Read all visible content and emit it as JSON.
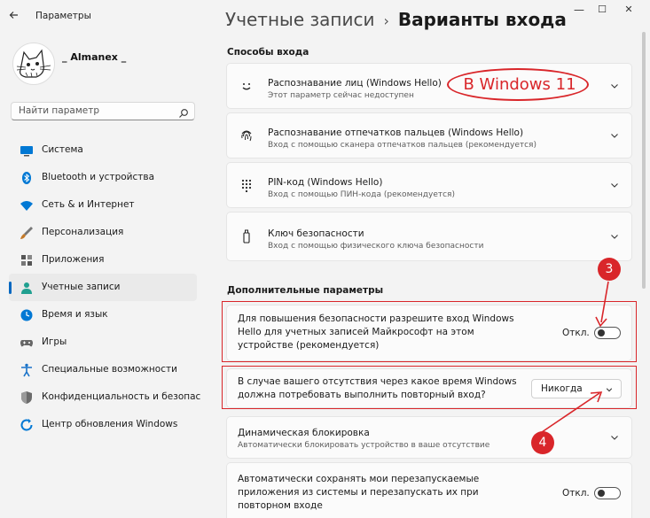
{
  "window": {
    "title": "Параметры",
    "minimize": "—",
    "maximize": "☐",
    "close": "✕"
  },
  "user": {
    "name": "_ Almanex _"
  },
  "search": {
    "placeholder": "Найти параметр"
  },
  "nav": [
    {
      "label": "Система",
      "icon": "monitor-icon",
      "color": "#0078d4"
    },
    {
      "label": "Bluetooth и устройства",
      "icon": "bluetooth-icon",
      "color": "#0078d4"
    },
    {
      "label": "Сеть & и Интернет",
      "icon": "wifi-icon",
      "color": "#0078d4"
    },
    {
      "label": "Персонализация",
      "icon": "brush-icon",
      "color": "#c47a29"
    },
    {
      "label": "Приложения",
      "icon": "apps-icon",
      "color": "#555555"
    },
    {
      "label": "Учетные записи",
      "icon": "person-icon",
      "color": "#20a090",
      "active": true
    },
    {
      "label": "Время и язык",
      "icon": "globe-clock-icon",
      "color": "#0078d4"
    },
    {
      "label": "Игры",
      "icon": "gamepad-icon",
      "color": "#666666"
    },
    {
      "label": "Специальные возможности",
      "icon": "accessibility-icon",
      "color": "#1a73c9"
    },
    {
      "label": "Конфиденциальность и безопас",
      "icon": "shield-icon",
      "color": "#6b6b6b"
    },
    {
      "label": "Центр обновления Windows",
      "icon": "update-icon",
      "color": "#0078d4"
    }
  ],
  "header": {
    "parent": "Учетные записи",
    "separator": "›",
    "current": "Варианты входа"
  },
  "signin": {
    "title": "Способы входа",
    "items": [
      {
        "title": "Распознавание лиц (Windows Hello)",
        "subtitle": "Этот параметр сейчас недоступен"
      },
      {
        "title": "Распознавание отпечатков пальцев (Windows Hello)",
        "subtitle": "Вход с помощью сканера отпечатков пальцев (рекомендуется)"
      },
      {
        "title": "PIN-код (Windows Hello)",
        "subtitle": "Вход с помощью ПИН-кода (рекомендуется)"
      },
      {
        "title": "Ключ безопасности",
        "subtitle": "Вход с помощью физического ключа безопасности"
      }
    ]
  },
  "additional": {
    "title": "Дополнительные параметры",
    "hello_only": {
      "lines": [
        "Для повышения безопасности разрешите вход Windows",
        "Hello для учетных записей Майкрософт на этом",
        "устройстве (рекомендуется)"
      ],
      "state": "Откл."
    },
    "require_signin": {
      "lines": [
        "В случае вашего отсутствия через какое время Windows",
        "должна потребовать выполнить повторный вход?"
      ],
      "value": "Никогда"
    },
    "dynamic_lock": {
      "title": "Динамическая блокировка",
      "subtitle": "Автоматически блокировать устройство в ваше отсутствие"
    },
    "restart_apps": {
      "lines": [
        "Автоматически сохранять мои перезапускаемые",
        "приложения из системы и перезапускать их при",
        "повторном входе"
      ],
      "state": "Откл."
    }
  },
  "annotations": {
    "oval": "В Windows 11",
    "badge_3": "3",
    "badge_4": "4",
    "color": "#d9262a"
  }
}
